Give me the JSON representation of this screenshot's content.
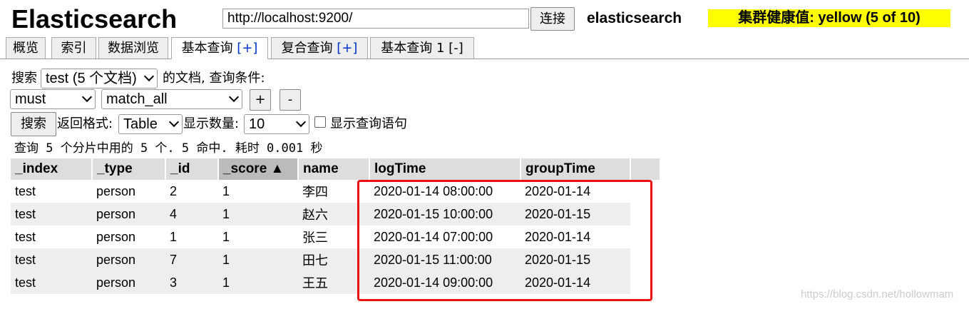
{
  "app_title": "Elasticsearch",
  "url_value": "http://localhost:9200/",
  "connect_label": "连接",
  "cluster_name": "elasticsearch",
  "cluster_health": "集群健康值: yellow (5 of 10)",
  "tabs": [
    {
      "label": "概览"
    },
    {
      "label": "索引"
    },
    {
      "label": "数据浏览"
    },
    {
      "label": "基本查询",
      "suffix": "[+]"
    },
    {
      "label": "复合查询",
      "suffix": "[+]"
    },
    {
      "label": "基本查询 1 [-]"
    }
  ],
  "query": {
    "search_label": "搜索",
    "index_select": "test (5 个文档)",
    "docs_label": "的文档,  查询条件:",
    "bool_select": "must",
    "match_select": "match_all",
    "add_label": "+",
    "remove_label": "-",
    "search_button": "搜索",
    "format_label": "返回格式:",
    "format_select": "Table",
    "count_label": "显示数量:",
    "count_select": "10",
    "show_query_label": "显示查询语句"
  },
  "stats_text": "查询 5 个分片中用的 5 个. 5 命中. 耗时 0.001 秒",
  "columns": [
    "_index",
    "_type",
    "_id",
    "_score ▲",
    "name",
    "logTime",
    "groupTime"
  ],
  "rows": [
    [
      "test",
      "person",
      "2",
      "1",
      "李四",
      "2020-01-14 08:00:00",
      "2020-01-14"
    ],
    [
      "test",
      "person",
      "4",
      "1",
      "赵六",
      "2020-01-15 10:00:00",
      "2020-01-15"
    ],
    [
      "test",
      "person",
      "1",
      "1",
      "张三",
      "2020-01-14 07:00:00",
      "2020-01-14"
    ],
    [
      "test",
      "person",
      "7",
      "1",
      "田七",
      "2020-01-15 11:00:00",
      "2020-01-15"
    ],
    [
      "test",
      "person",
      "3",
      "1",
      "王五",
      "2020-01-14 09:00:00",
      "2020-01-14"
    ]
  ],
  "watermark": "https://blog.csdn.net/hollowmam",
  "colors": {
    "health_bg": "#ffff00",
    "highlight_border": "#ee1111",
    "link_blue": "#0033cc"
  }
}
